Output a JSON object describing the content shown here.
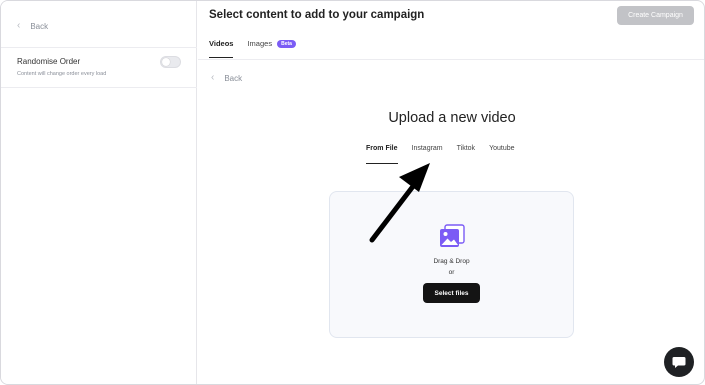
{
  "sidebar": {
    "back_label": "Back",
    "randomise": {
      "title": "Randomise Order",
      "subtitle": "Content will change order every load",
      "enabled": false
    }
  },
  "main": {
    "title": "Select content to add to your campaign",
    "create_button": "Create Campaign",
    "tabs": [
      {
        "label": "Videos",
        "active": true
      },
      {
        "label": "Images",
        "active": false,
        "badge": "Beta"
      }
    ],
    "back_label": "Back",
    "upload": {
      "title": "Upload a new video",
      "source_tabs": [
        {
          "label": "From File",
          "active": true
        },
        {
          "label": "Instagram",
          "active": false
        },
        {
          "label": "Tiktok",
          "active": false
        },
        {
          "label": "Youtube",
          "active": false
        }
      ],
      "dropzone": {
        "icon": "image-stack-icon",
        "drag_text": "Drag & Drop",
        "or_text": "or",
        "button": "Select files"
      }
    }
  },
  "chat_icon": "chat-bubble-icon",
  "colors": {
    "accent": "#7b5cf5",
    "disabled_button": "#c2c3c7",
    "primary_button": "#141414",
    "annotation_arrow": "#000000"
  }
}
